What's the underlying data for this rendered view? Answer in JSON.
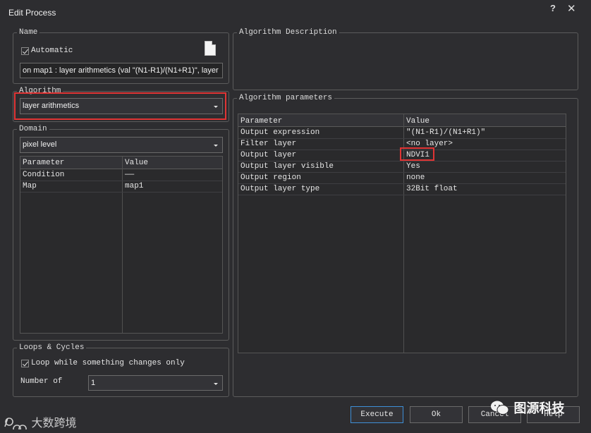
{
  "window": {
    "title": "Edit Process",
    "help_glyph": "?",
    "close_glyph": "✕"
  },
  "name_group": {
    "legend": "Name",
    "automatic_label": "Automatic",
    "automatic_checked": true,
    "name_value": "on map1 : layer arithmetics (val \"(N1-R1)/(N1+R1)\", layer"
  },
  "algorithm_group": {
    "legend": "Algorithm",
    "selected": "layer arithmetics"
  },
  "domain_group": {
    "legend": "Domain",
    "selected": "pixel level",
    "columns": [
      "Parameter",
      "Value"
    ],
    "rows": [
      {
        "param": "Condition",
        "value": "——"
      },
      {
        "param": "Map",
        "value": "map1"
      }
    ]
  },
  "loops_group": {
    "legend": "Loops & Cycles",
    "loop_label": "Loop while something changes only",
    "loop_checked": true,
    "number_label": "Number of",
    "number_value": "1"
  },
  "description_group": {
    "legend": "Algorithm Description"
  },
  "parameters_group": {
    "legend": "Algorithm parameters",
    "columns": [
      "Parameter",
      "Value"
    ],
    "rows": [
      {
        "param": "Output expression",
        "value": "\"(N1-R1)/(N1+R1)\""
      },
      {
        "param": "Filter layer",
        "value": "<no layer>"
      },
      {
        "param": "Output layer",
        "value": "NDVI1"
      },
      {
        "param": "Output layer visible",
        "value": "Yes"
      },
      {
        "param": "Output region",
        "value": "none"
      },
      {
        "param": "Output layer type",
        "value": "32Bit float"
      }
    ]
  },
  "buttons": {
    "execute": "Execute",
    "ok": "Ok",
    "cancel": "Cancel",
    "help": "Help"
  },
  "watermarks": {
    "left": "大数跨境",
    "right": "图源科技"
  },
  "colors": {
    "highlight_red": "#e03434",
    "primary_border": "#3e8fd6",
    "background": "#2d2d30"
  }
}
